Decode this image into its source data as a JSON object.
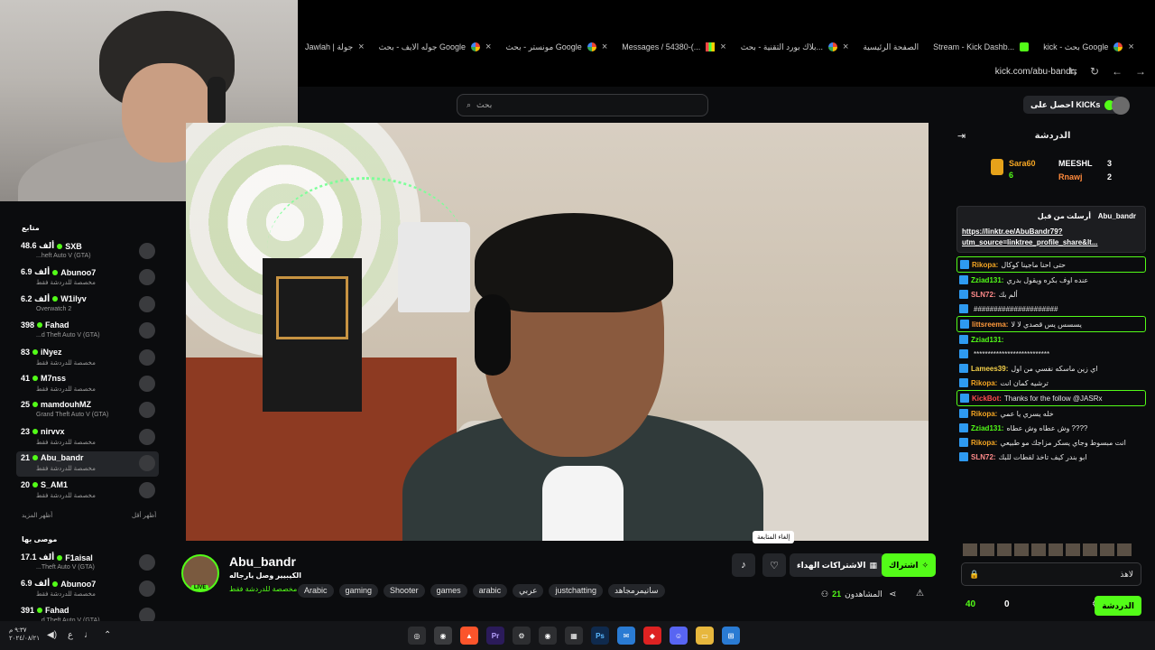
{
  "browser": {
    "tabs": [
      {
        "label": "Jawlah | جولة"
      },
      {
        "label": "جوله الايف - بحث Google"
      },
      {
        "label": "مونستر - بحث Google"
      },
      {
        "label": "Messages / 54380-(..."
      },
      {
        "label": "بلاك بورد التقنية - بحث..."
      },
      {
        "label": "الصفحة الرئيسية"
      },
      {
        "label": "Stream - Kick Dashb..."
      },
      {
        "label": "kick - بحث Google"
      }
    ],
    "url": "kick.com/abu-bandr"
  },
  "header": {
    "search_placeholder": "بحث",
    "get_kicks": "احصل على KICKs"
  },
  "sidebar": {
    "heading": "متابع",
    "items": [
      {
        "name": "SXB",
        "count": "48.6 ألف",
        "sub": "...heft Auto V (GTA)"
      },
      {
        "name": "Abunoo7",
        "count": "6.9 ألف",
        "sub": "مخصصة للدردشة فقط"
      },
      {
        "name": "W1ilyv",
        "count": "6.2 ألف",
        "sub": "Overwatch 2"
      },
      {
        "name": "Fahad",
        "count": "398",
        "sub": "...d Theft Auto V (GTA)"
      },
      {
        "name": "iNyez",
        "count": "83",
        "sub": "مخصصة للدردشة فقط"
      },
      {
        "name": "M7nss",
        "count": "41",
        "sub": "مخصصة للدردشة فقط"
      },
      {
        "name": "mamdouhMZ",
        "count": "25",
        "sub": "Grand Theft Auto V (GTA)"
      },
      {
        "name": "nirvvx",
        "count": "23",
        "sub": "مخصصة للدردشة فقط"
      },
      {
        "name": "Abu_bandr",
        "count": "21",
        "sub": "مخصصة للدردشة فقط"
      },
      {
        "name": "S_AM1",
        "count": "20",
        "sub": "مخصصة للدردشة فقط"
      }
    ],
    "show_more": "أظهر المزيد",
    "show_less": "أظهر أقل",
    "heading2": "موصى بها",
    "items2": [
      {
        "name": "F1aisal",
        "count": "17.1 ألف",
        "sub": "...Theft Auto V (GTA)"
      },
      {
        "name": "Abunoo7",
        "count": "6.9 ألف",
        "sub": "مخصصة للدردشة فقط"
      },
      {
        "name": "Fahad",
        "count": "391",
        "sub": "...d Theft Auto V (GTA)"
      }
    ]
  },
  "channel": {
    "name": "Abu_bandr",
    "live": "LIVE",
    "title": "الكيبيير وصل يارجاله",
    "category": "مخصصة للدردشة فقط",
    "tags": [
      "Arabic",
      "gaming",
      "Shooter",
      "games",
      "arabic",
      "عربي",
      "justchatting",
      "ساتيمرمجاهد"
    ],
    "follow_label": "اشتراك",
    "gift_label": "الاشتراكات الهداء",
    "tooltip": "إلغاء المتابعة",
    "viewers_label": "المشاهدون",
    "viewers_count": "21"
  },
  "chat": {
    "title": "الدردشة",
    "leaderboard": [
      {
        "name": "Sara60",
        "value": "6"
      },
      {
        "name": "MEESHL",
        "value": "3"
      },
      {
        "name": "Rnawj",
        "value": "2"
      }
    ],
    "pinned_by": "أرسلت من قبل",
    "pinned_user": "Abu_bandr",
    "pinned_link": "https://linktr.ee/AbuBandr79?utm_source=linktree_profile_share&lt...",
    "messages": [
      {
        "user": "Rikopa:",
        "text": "حتى احنا ماجينا كوكال",
        "color": "#f5a623",
        "hl": true
      },
      {
        "user": "Zziad131:",
        "text": "عنده اوف بكره ويقول بدري",
        "color": "#53fc18",
        "hl": false
      },
      {
        "user": "SLN72:",
        "text": "ألم بك",
        "color": "#ff8a8a",
        "hl": false
      },
      {
        "user": "",
        "text": "#####################",
        "color": "#e5e5e5",
        "hl": false
      },
      {
        "user": "littsreema:",
        "text": "يسسس يس قصدي لا لا",
        "color": "#ff9a3c",
        "hl": true
      },
      {
        "user": "Zziad131:",
        "text": "",
        "color": "#53fc18",
        "hl": false
      },
      {
        "user": "",
        "text": "***************************",
        "color": "#e5e5e5",
        "hl": false
      },
      {
        "user": "Lamees39:",
        "text": "اي زين ماسكه نفسي من اول",
        "color": "#f5d14a",
        "hl": false
      },
      {
        "user": "Rikopa:",
        "text": "ترشيه كمان انت",
        "color": "#f5a623",
        "hl": false
      },
      {
        "user": "KickBot:",
        "text": "Thanks for the follow @JASRx",
        "color": "#ff4d4d",
        "hl": true
      },
      {
        "user": "Rikopa:",
        "text": "خله يسري يا عمي",
        "color": "#f5a623",
        "hl": false
      },
      {
        "user": "Zziad131:",
        "text": "وش عطاه وش عطاه ????",
        "color": "#53fc18",
        "hl": false
      },
      {
        "user": "Rikopa:",
        "text": "انت مبسوط وجاي يسكر مزاجك مو طبيعي",
        "color": "#f5a623",
        "hl": false
      },
      {
        "user": "SLN72:",
        "text": "ابو بندر كيف تاخذ لقطات للبك",
        "color": "#ff8a8a",
        "hl": false
      }
    ],
    "input_placeholder": "لاهذ",
    "points": "40",
    "zero": "0",
    "send_label": "الدردشة"
  },
  "taskbar": {
    "time": "٩:٣٧ م",
    "date": "٢٠٢٤/٠٨/٢١"
  }
}
